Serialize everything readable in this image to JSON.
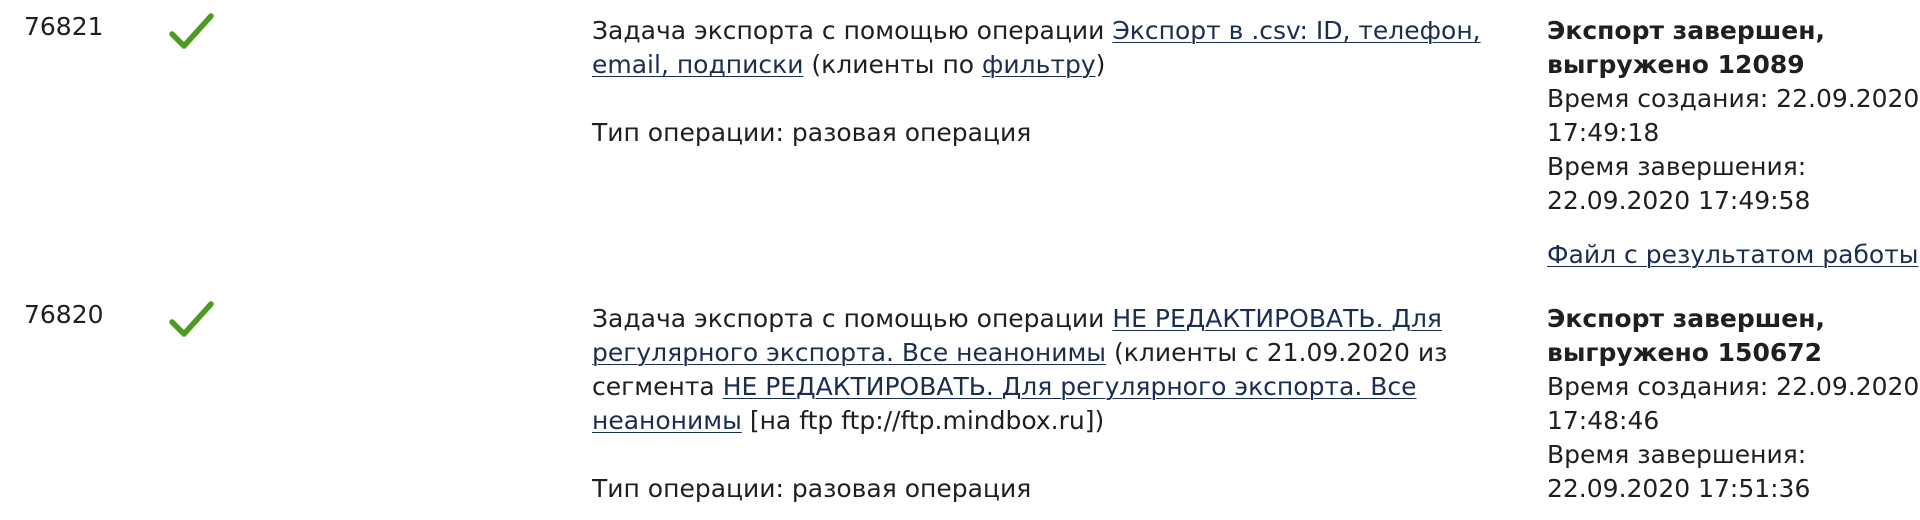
{
  "tasks": [
    {
      "id": "76821",
      "status_icon": "checkmark-icon",
      "desc_prefix": "Задача экспорта с помощью операции ",
      "op_link": "Экспорт в .csv: ID, телефон, email, подписки",
      "mid1": " (клиенты по ",
      "filter_link": "фильтру",
      "end1": ")",
      "type": "Тип операции: разовая операция",
      "result_title": "Экспорт завершен, выгружено 12089",
      "created": "Время создания: 22.09.2020 17:49:18",
      "finished": "Время завершения: 22.09.2020 17:49:58",
      "file_link": "Файл с результатом работы"
    },
    {
      "id": "76820",
      "status_icon": "checkmark-icon",
      "desc_prefix": "Задача экспорта с помощью операции ",
      "op_link": "НЕ РЕДАКТИРОВАТЬ. Для регулярного экспорта. Все неанонимы",
      "mid1": " (клиенты с 21.09.2020 из сегмента ",
      "segment_link": "НЕ РЕДАКТИРОВАТЬ. Для регулярного экспорта. Все неанонимы",
      "end1": " [на ftp ftp://ftp.mindbox.ru])",
      "type": "Тип операции: разовая операция",
      "result_title": "Экспорт завершен, выгружено 150672",
      "created": "Время создания: 22.09.2020 17:48:46",
      "finished": "Время завершения: 22.09.2020 17:51:36"
    }
  ],
  "colors": {
    "check": "#4d9a1e",
    "link": "#1a2e50",
    "text": "#1f1f1f"
  }
}
